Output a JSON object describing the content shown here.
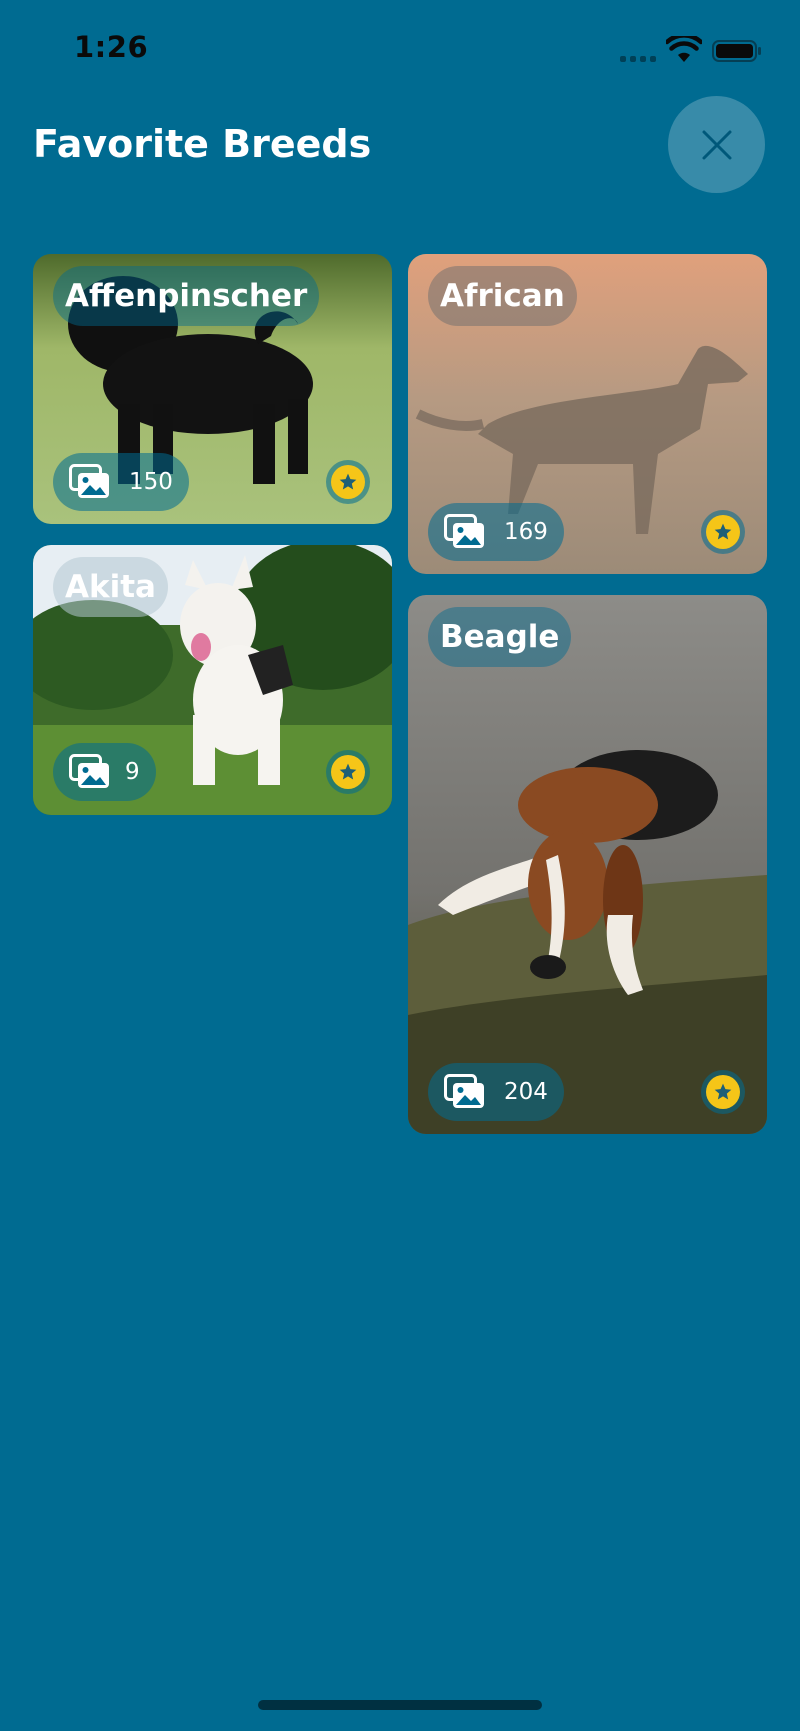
{
  "status_bar": {
    "time": "1:26"
  },
  "header": {
    "title": "Favorite Breeds",
    "close_icon": "close-icon"
  },
  "colors": {
    "background": "#006b91",
    "star": "#f5c518",
    "text": "#ffffff"
  },
  "breeds": [
    {
      "name": "Affenpinscher",
      "count": "150",
      "favorite": true
    },
    {
      "name": "African",
      "count": "169",
      "favorite": true
    },
    {
      "name": "Akita",
      "count": "9",
      "favorite": true
    },
    {
      "name": "Beagle",
      "count": "204",
      "favorite": true
    }
  ]
}
